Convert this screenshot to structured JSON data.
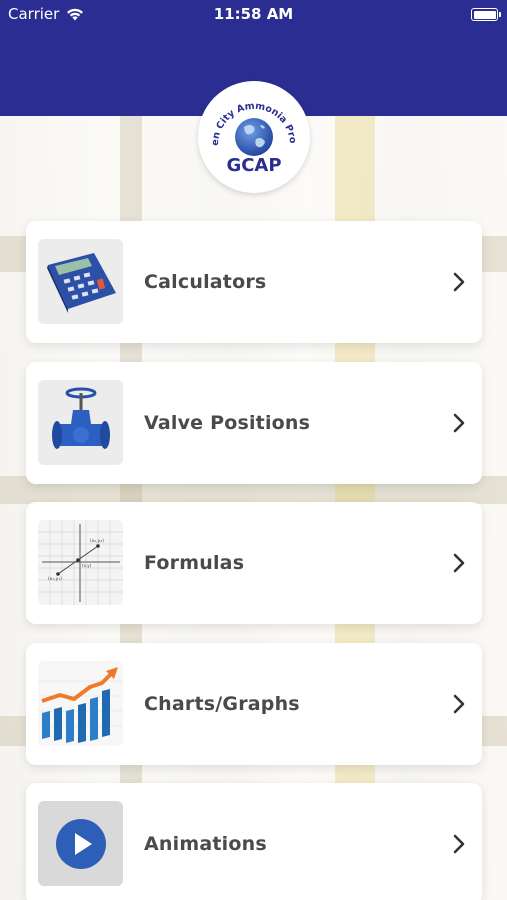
{
  "status_bar": {
    "carrier": "Carrier",
    "time": "11:58 AM"
  },
  "header": {
    "logo_arc_text": "Garden City Ammonia Program",
    "logo_abbrev": "GCAP",
    "color": "#2b2d92"
  },
  "menu": {
    "items": [
      {
        "label": "Calculators",
        "icon": "calculator-icon"
      },
      {
        "label": "Valve Positions",
        "icon": "valve-icon"
      },
      {
        "label": "Formulas",
        "icon": "graph-formula-icon"
      },
      {
        "label": "Charts/Graphs",
        "icon": "bar-chart-icon"
      },
      {
        "label": "Animations",
        "icon": "play-icon"
      }
    ]
  }
}
